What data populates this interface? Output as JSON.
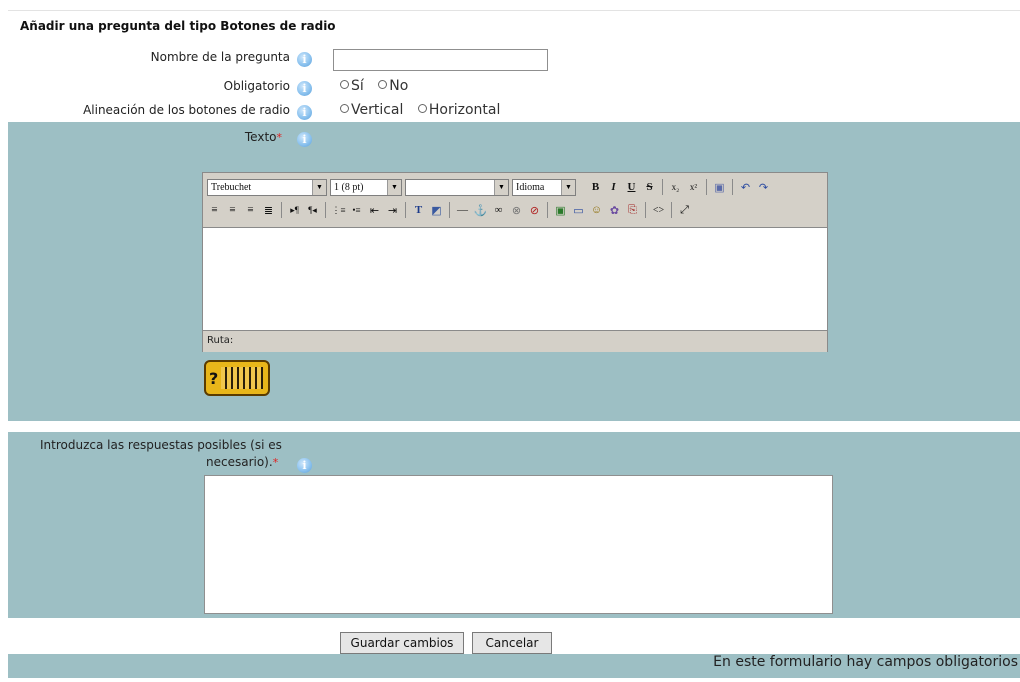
{
  "form": {
    "title": "Añadir una pregunta del tipo Botones de radio",
    "name_label": "Nombre de la pregunta",
    "name_value": "",
    "required_label": "Obligatorio",
    "required_options": [
      "Sí",
      "No"
    ],
    "alignment_label": "Alineación de los botones de radio",
    "alignment_options": [
      "Vertical",
      "Horizontal"
    ],
    "text_label": "Texto",
    "answers_label_line1": "Introduzca las respuestas posibles (si es",
    "answers_label_line2": "necesario).",
    "required_star": "*"
  },
  "editor": {
    "font_family": "Trebuchet",
    "font_size": "1 (8 pt)",
    "format": "",
    "language": "Idioma",
    "path_label": "Ruta:",
    "content": "",
    "toolbar_row1": [
      {
        "name": "bold-icon",
        "glyph": "B"
      },
      {
        "name": "italic-icon",
        "glyph": "I"
      },
      {
        "name": "underline-icon",
        "glyph": "U"
      },
      {
        "name": "strikethrough-icon",
        "glyph": "S"
      },
      {
        "name": "subscript-icon",
        "glyph": "x₂"
      },
      {
        "name": "superscript-icon",
        "glyph": "x²"
      },
      {
        "name": "clean-word-icon",
        "glyph": "▣"
      },
      {
        "name": "undo-icon",
        "glyph": "↶"
      },
      {
        "name": "redo-icon",
        "glyph": "↷"
      }
    ],
    "toolbar_row2": [
      {
        "name": "align-left-icon",
        "glyph": "≡"
      },
      {
        "name": "align-center-icon",
        "glyph": "≡"
      },
      {
        "name": "align-right-icon",
        "glyph": "≡"
      },
      {
        "name": "justify-icon",
        "glyph": "≣"
      },
      {
        "name": "ltr-icon",
        "glyph": "▸¶"
      },
      {
        "name": "rtl-icon",
        "glyph": "¶◂"
      },
      {
        "name": "ordered-list-icon",
        "glyph": "⋮≡"
      },
      {
        "name": "unordered-list-icon",
        "glyph": "•≡"
      },
      {
        "name": "outdent-icon",
        "glyph": "⇤"
      },
      {
        "name": "indent-icon",
        "glyph": "⇥"
      },
      {
        "name": "text-color-icon",
        "glyph": "T"
      },
      {
        "name": "background-color-icon",
        "glyph": "◩"
      },
      {
        "name": "horizontal-rule-icon",
        "glyph": "—"
      },
      {
        "name": "anchor-icon",
        "glyph": "⚓"
      },
      {
        "name": "link-icon",
        "glyph": "∞"
      },
      {
        "name": "unlink-icon",
        "glyph": "⊗"
      },
      {
        "name": "nolink-icon",
        "glyph": "⊘"
      },
      {
        "name": "image-icon",
        "glyph": "▣"
      },
      {
        "name": "table-icon",
        "glyph": "▭"
      },
      {
        "name": "smiley-icon",
        "glyph": "☺"
      },
      {
        "name": "special-char-icon",
        "glyph": "✿"
      },
      {
        "name": "search-replace-icon",
        "glyph": "⎘"
      },
      {
        "name": "html-source-icon",
        "glyph": "<>"
      },
      {
        "name": "fullscreen-icon",
        "glyph": "⤢"
      }
    ]
  },
  "answers": {
    "value": ""
  },
  "buttons": {
    "save": "Guardar cambios",
    "cancel": "Cancelar"
  },
  "footer_note": "En este formulario hay campos obligatorios",
  "colors": {
    "band": "#9dbfc4",
    "required": "#e02020"
  }
}
